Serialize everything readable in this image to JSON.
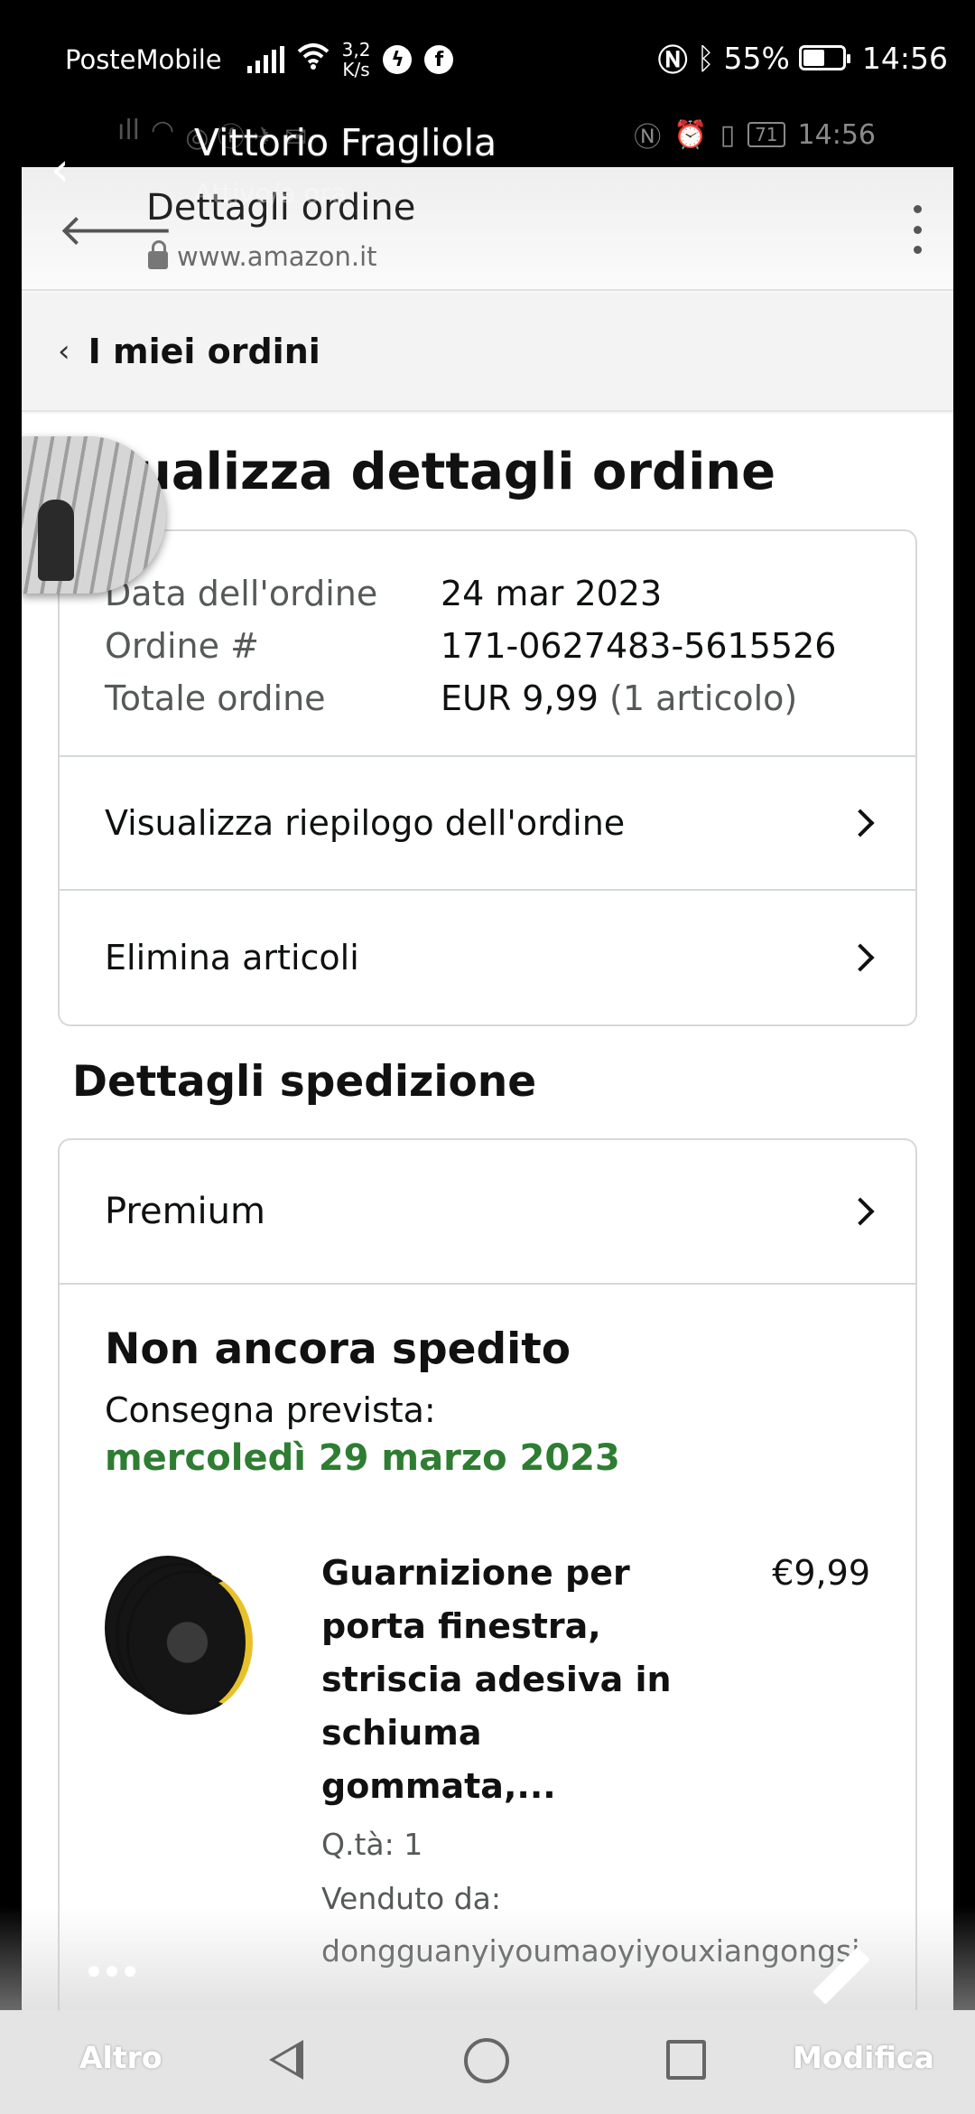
{
  "status_bar": {
    "carrier": "PosteMobile",
    "net_speed_value": "3,2",
    "net_speed_unit": "K/s",
    "battery_pct": "55%",
    "battery_level": 0.55,
    "time": "14:56",
    "icons": [
      "signal-icon",
      "wifi-icon",
      "messenger-icon",
      "facebook-icon",
      "nfc-icon",
      "bluetooth-icon",
      "battery-icon"
    ]
  },
  "inner_status": {
    "battery": "71",
    "time": "14:56"
  },
  "overlay": {
    "contact_name": "Vittorio Fragliola",
    "contact_status": "Attivo/a ora"
  },
  "browser": {
    "title": "Dettagli ordine",
    "url": "www.amazon.it"
  },
  "nav": {
    "my_orders": "I miei ordini"
  },
  "page": {
    "heading_visible": "ualizza dettagli ordine",
    "order_info": [
      {
        "key": "Data dell'ordine",
        "value": "24 mar 2023",
        "muted": ""
      },
      {
        "key": "Ordine #",
        "value": "171-0627483-5615526",
        "muted": ""
      },
      {
        "key": "Totale ordine",
        "value": "EUR 9,99",
        "muted": " (1 articolo)"
      }
    ],
    "links": [
      "Visualizza riepilogo dell'ordine",
      "Elimina articoli"
    ],
    "shipping_heading": "Dettagli spedizione",
    "shipping_type": "Premium",
    "ship_status": "Non ancora spedito",
    "eta_label": "Consegna prevista:",
    "eta_date": "mercoledì 29 marzo 2023",
    "eta_color": "#2e7d32",
    "product": {
      "title": "Guarnizione per porta finestra, striscia adesiva in schiuma gommata,...",
      "price": "€9,99",
      "qty": "Q.tà: 1",
      "seller_label": "Venduto da:",
      "seller": "dongguanyiyoumaoyiyouxiangongsi"
    }
  },
  "bottom": {
    "left_label": "Altro",
    "right_label": "Modifica"
  }
}
